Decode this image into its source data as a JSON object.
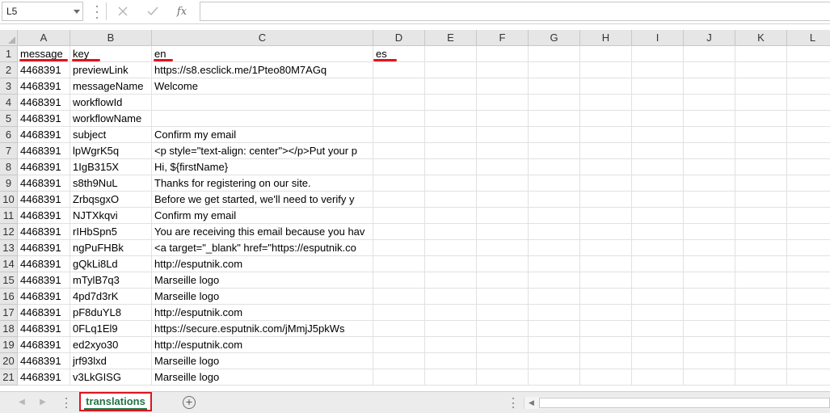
{
  "formula_bar": {
    "name_box": "L5",
    "cancel_icon": "close-icon",
    "enter_icon": "check-icon",
    "fx_label": "fx",
    "formula_value": ""
  },
  "columns": [
    "A",
    "B",
    "C",
    "D",
    "E",
    "F",
    "G",
    "H",
    "I",
    "J",
    "K",
    "L"
  ],
  "rows": [
    {
      "n": "1",
      "A": "message",
      "B": "key",
      "C": "en",
      "D": "es"
    },
    {
      "n": "2",
      "A": "4468391",
      "B": "previewLink",
      "C": "https://s8.esclick.me/1Pteo80M7AGq",
      "D": ""
    },
    {
      "n": "3",
      "A": "4468391",
      "B": "messageName",
      "C": "Welcome",
      "D": ""
    },
    {
      "n": "4",
      "A": "4468391",
      "B": "workflowId",
      "C": "",
      "D": ""
    },
    {
      "n": "5",
      "A": "4468391",
      "B": "workflowName",
      "C": "",
      "D": ""
    },
    {
      "n": "6",
      "A": "4468391",
      "B": "subject",
      "C": "Confirm my email",
      "D": ""
    },
    {
      "n": "7",
      "A": "4468391",
      "B": "lpWgrK5q",
      "C": "<p style=\"text-align: center\"></p>Put your p",
      "D": ""
    },
    {
      "n": "8",
      "A": "4468391",
      "B": "1IgB315X",
      "C": "Hi, ${firstName}",
      "D": ""
    },
    {
      "n": "9",
      "A": "4468391",
      "B": "s8th9NuL",
      "C": "Thanks for registering on our site.",
      "D": ""
    },
    {
      "n": "10",
      "A": "4468391",
      "B": "ZrbqsgxO",
      "C": "Before we get started, we'll need to verify y",
      "D": ""
    },
    {
      "n": "11",
      "A": "4468391",
      "B": "NJTXkqvi",
      "C": "Confirm my email",
      "D": ""
    },
    {
      "n": "12",
      "A": "4468391",
      "B": "rIHbSpn5",
      "C": "You are receiving this email because you hav",
      "D": ""
    },
    {
      "n": "13",
      "A": "4468391",
      "B": "ngPuFHBk",
      "C": "<a target=\"_blank\" href=\"https://esputnik.co",
      "D": ""
    },
    {
      "n": "14",
      "A": "4468391",
      "B": "gQkLi8Ld",
      "C": "http://esputnik.com",
      "D": ""
    },
    {
      "n": "15",
      "A": "4468391",
      "B": "mTylB7q3",
      "C": "Marseille logo",
      "D": ""
    },
    {
      "n": "16",
      "A": "4468391",
      "B": "4pd7d3rK",
      "C": "Marseille logo",
      "D": ""
    },
    {
      "n": "17",
      "A": "4468391",
      "B": "pF8duYL8",
      "C": "http://esputnik.com",
      "D": ""
    },
    {
      "n": "18",
      "A": "4468391",
      "B": "0FLq1El9",
      "C": "https://secure.esputnik.com/jMmjJ5pkWs",
      "D": ""
    },
    {
      "n": "19",
      "A": "4468391",
      "B": "ed2xyo30",
      "C": "http://esputnik.com",
      "D": ""
    },
    {
      "n": "20",
      "A": "4468391",
      "B": "jrf93lxd",
      "C": "Marseille logo",
      "D": ""
    },
    {
      "n": "21",
      "A": "4468391",
      "B": "v3LkGISG",
      "C": "Marseille logo",
      "D": ""
    }
  ],
  "sheet_tabs": [
    {
      "label": "translations",
      "active": true
    }
  ],
  "colors": {
    "annotation_red": "#e0141e",
    "excel_green": "#217346",
    "header_gray": "#e6e6e6"
  }
}
